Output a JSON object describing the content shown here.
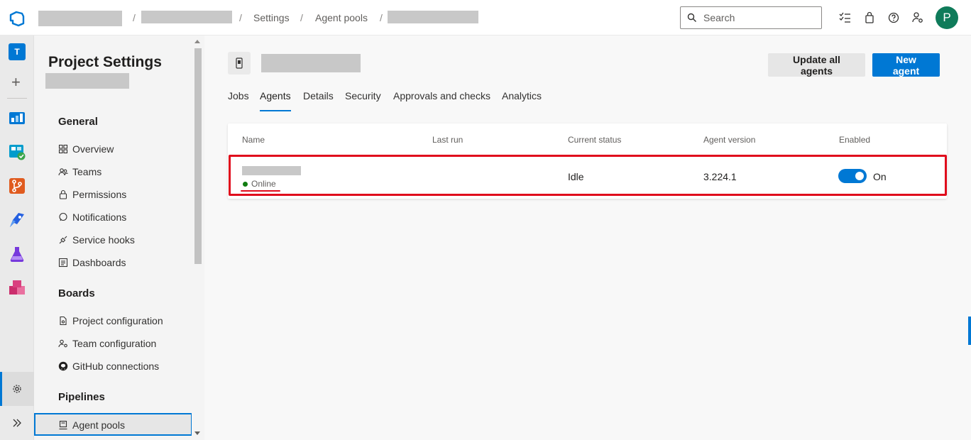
{
  "header": {
    "breadcrumb": {
      "separator": "/",
      "items": [
        "Settings",
        "Agent pools"
      ]
    },
    "search": {
      "placeholder": "Search"
    },
    "user_initial": "P"
  },
  "appbar": {
    "project_initial": "T"
  },
  "sidebar": {
    "title": "Project Settings",
    "sections": [
      {
        "heading": "General",
        "items": [
          "Overview",
          "Teams",
          "Permissions",
          "Notifications",
          "Service hooks",
          "Dashboards"
        ]
      },
      {
        "heading": "Boards",
        "items": [
          "Project configuration",
          "Team configuration",
          "GitHub connections"
        ]
      },
      {
        "heading": "Pipelines",
        "items": [
          "Agent pools"
        ]
      }
    ]
  },
  "main": {
    "buttons": {
      "update_all": "Update all agents",
      "new_agent": "New agent"
    },
    "tabs": [
      "Jobs",
      "Agents",
      "Details",
      "Security",
      "Approvals and checks",
      "Analytics"
    ],
    "active_tab": "Agents",
    "table": {
      "columns": [
        "Name",
        "Last run",
        "Current status",
        "Agent version",
        "Enabled"
      ],
      "rows": [
        {
          "status": "Online",
          "last_run": "",
          "current_status": "Idle",
          "agent_version": "3.224.1",
          "enabled": "On"
        }
      ]
    }
  },
  "colors": {
    "accent": "#0078d4",
    "online": "#107c10",
    "highlight": "#e00b1c"
  }
}
